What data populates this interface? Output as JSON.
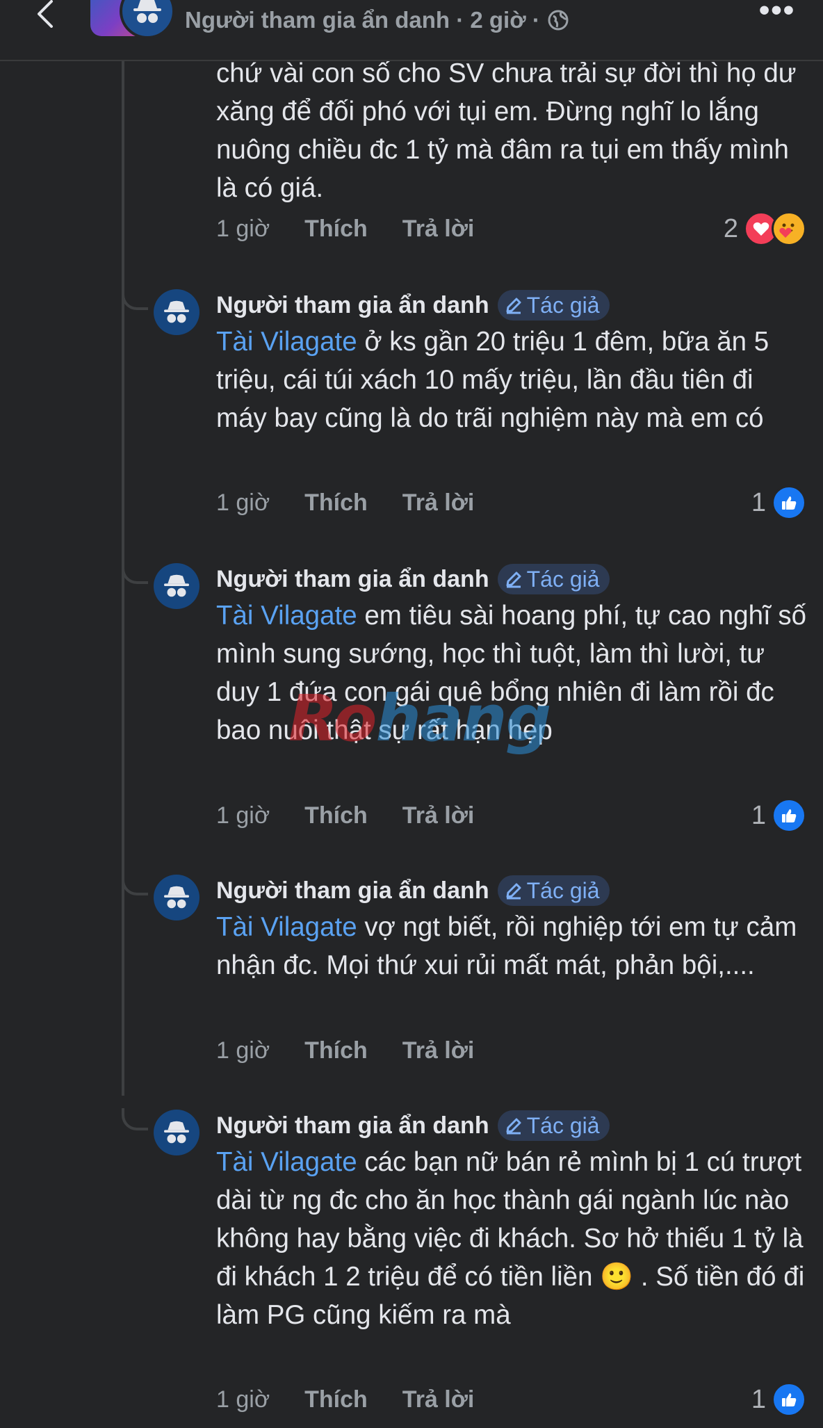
{
  "header": {
    "meta_text": "Người tham gia ẩn danh · 2 giờ ·",
    "more_label": "•••"
  },
  "first_comment": {
    "text_lines": "chứ vài con số cho SV chưa trải sự đời thì họ dư xăng để đối phó với tụi em. Đừng nghĩ lo lắng nuông chiều  đc 1 tỷ mà đâm ra tụi em thấy mình là có giá.",
    "time": "1 giờ",
    "like_label": "Thích",
    "reply_label": "Trả lời",
    "reaction_count": "2",
    "reactions": [
      "love-reaction-icon",
      "care-reaction-icon"
    ]
  },
  "replies": [
    {
      "author": "Người tham gia ẩn danh",
      "badge": "Tác giả",
      "mention": "Tài Vilagate",
      "text": " ở ks gần 20 triệu 1 đêm, bữa ăn 5 triệu, cái túi xách 10 mấy triệu, lần đầu tiên đi máy bay cũng là do trãi nghiệm này mà em có",
      "time": "1 giờ",
      "like_label": "Thích",
      "reply_label": "Trả lời",
      "reaction_count": "1"
    },
    {
      "author": "Người tham gia ẩn danh",
      "badge": "Tác giả",
      "mention": "Tài Vilagate",
      "text": " em tiêu sài hoang phí, tự cao nghĩ số mình sung sướng, học thì tuột, làm thì lười, tư duy 1 đứa con gái quê bổng nhiên đi làm rồi đc bao nuôi thật sự rất hạn hẹp",
      "time": "1 giờ",
      "like_label": "Thích",
      "reply_label": "Trả lời",
      "reaction_count": "1"
    },
    {
      "author": "Người tham gia ẩn danh",
      "badge": "Tác giả",
      "mention": "Tài Vilagate",
      "text": " vợ ngt biết, rồi nghiệp tới em tự cảm nhận đc. Mọi thứ xui rủi mất mát, phản bội,....",
      "time": "1 giờ",
      "like_label": "Thích",
      "reply_label": "Trả lời",
      "reaction_count": ""
    },
    {
      "author": "Người tham gia ẩn danh",
      "badge": "Tác giả",
      "mention": "Tài Vilagate",
      "text_before_emoji": " các bạn nữ bán rẻ mình bị 1 cú trượt dài từ ng đc cho ăn học thành gái ngành lúc nào không hay bằng việc đi khách. Sơ hở thiếu 1 tỷ là đi khách 1 2 triệu để có tiền liền ",
      "emoji": "🙂",
      "text_after_emoji": " . Số tiền đó đi làm PG cũng kiếm ra mà",
      "time": "1 giờ",
      "like_label": "Thích",
      "reply_label": "Trả lời",
      "reaction_count": "1"
    }
  ],
  "watermark": {
    "part1": "Ro",
    "part2": "hang"
  },
  "colors": {
    "background": "#242527",
    "mention": "#5aa2f2",
    "badge_text": "#7fb0f5",
    "like_reaction": "#1877f2",
    "love_reaction": "#f33e58"
  }
}
